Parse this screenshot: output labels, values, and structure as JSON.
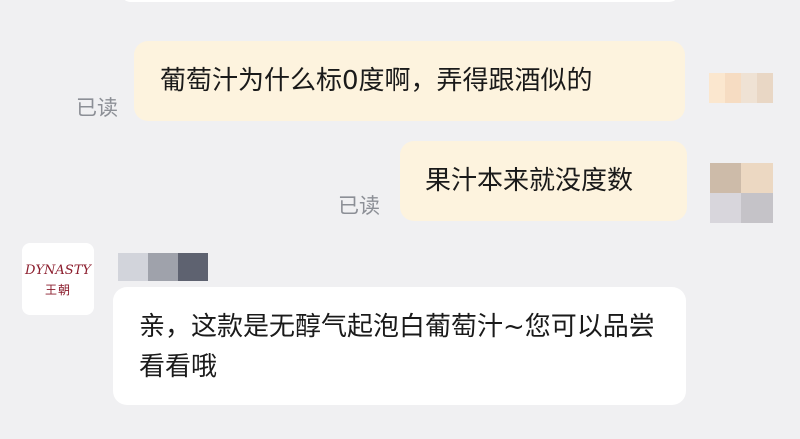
{
  "messages": [
    {
      "id": "msg1",
      "direction": "outgoing",
      "text": "葡萄汁为什么标0度啊，弄得跟酒似的",
      "status": "已读"
    },
    {
      "id": "msg2",
      "direction": "outgoing",
      "text": "果汁本来就没度数",
      "status": "已读"
    },
    {
      "id": "msg3",
      "direction": "incoming",
      "text": "亲，这款是无醇气起泡白葡萄汁~您可以品尝看看哦"
    }
  ],
  "merchant": {
    "logo_text": "DYNASTY",
    "logo_subtext": "王朝"
  },
  "colors": {
    "background": "#f0f0f2",
    "outgoing_bubble": "#fdf3de",
    "incoming_bubble": "#ffffff",
    "read_status": "#8c8f96",
    "logo": "#8b1c2c"
  }
}
